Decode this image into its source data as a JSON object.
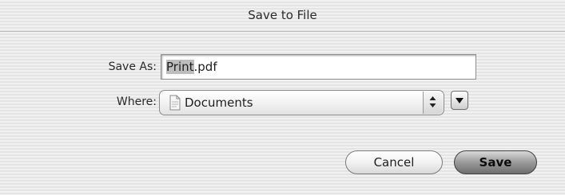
{
  "dialog": {
    "title": "Save to File"
  },
  "save_as": {
    "label": "Save As:",
    "value_selected": "Print",
    "value_rest": ".pdf"
  },
  "where": {
    "label": "Where:",
    "selected": "Documents",
    "icon": "folder-document-icon"
  },
  "buttons": {
    "cancel": "Cancel",
    "save": "Save"
  },
  "colors": {
    "background": "#ededed",
    "default_button": "#8e8e8e"
  }
}
